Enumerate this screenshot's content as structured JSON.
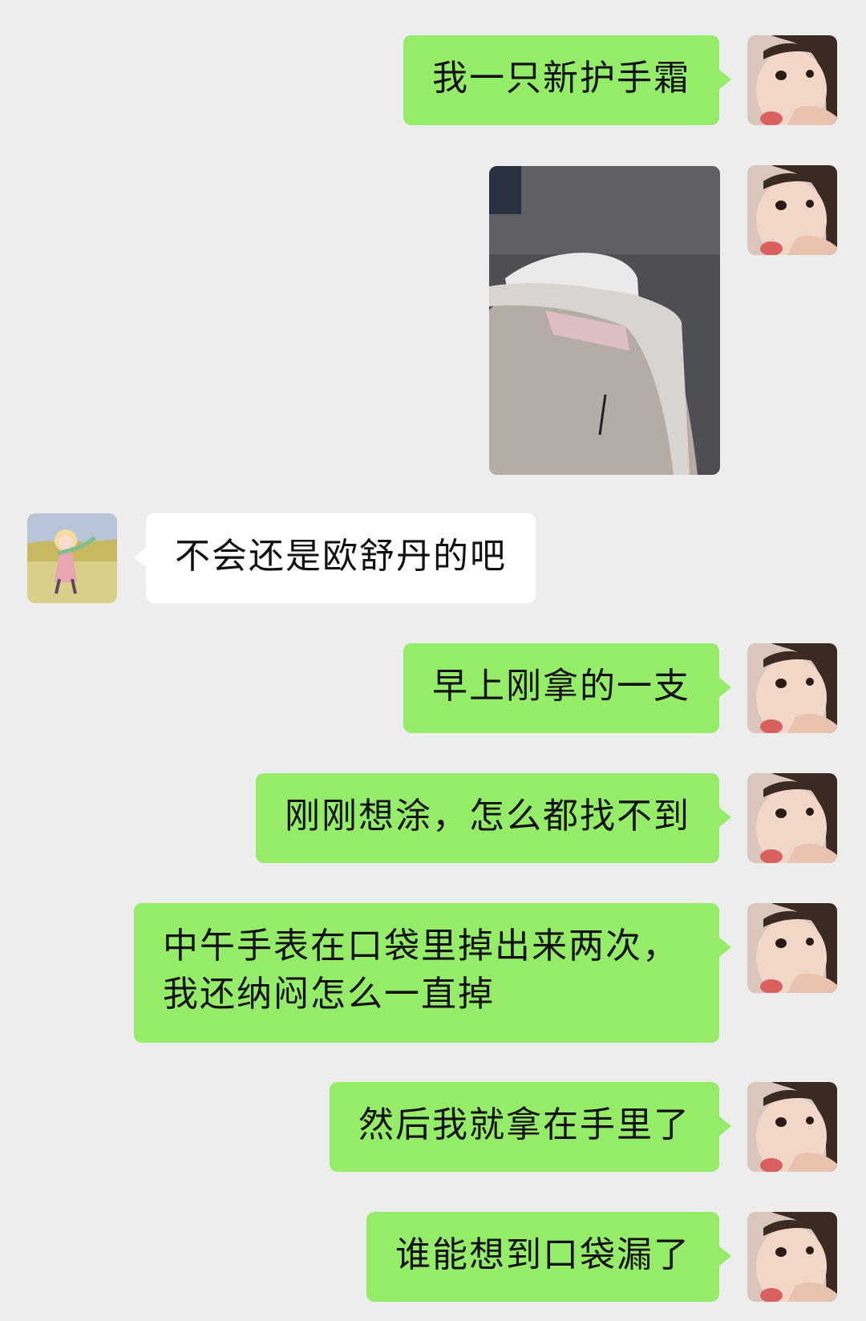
{
  "messages": [
    {
      "sender": "me",
      "type": "text",
      "text": "我一只新护手霜"
    },
    {
      "sender": "me",
      "type": "image"
    },
    {
      "sender": "other",
      "type": "text",
      "text": "不会还是欧舒丹的吧"
    },
    {
      "sender": "me",
      "type": "text",
      "text": "早上刚拿的一支"
    },
    {
      "sender": "me",
      "type": "text",
      "text": "刚刚想涂，怎么都找不到"
    },
    {
      "sender": "me",
      "type": "text",
      "text": "中午手表在口袋里掉出来两次，我还纳闷怎么一直掉"
    },
    {
      "sender": "me",
      "type": "text",
      "text": "然后我就拿在手里了"
    },
    {
      "sender": "me",
      "type": "text",
      "text": "谁能想到口袋漏了"
    }
  ],
  "colors": {
    "background": "#ededed",
    "sent_bubble": "#95ec69",
    "received_bubble": "#ffffff"
  },
  "icons": {
    "self_avatar": "child-avatar-icon",
    "other_avatar": "illustrated-girl-avatar-icon"
  }
}
